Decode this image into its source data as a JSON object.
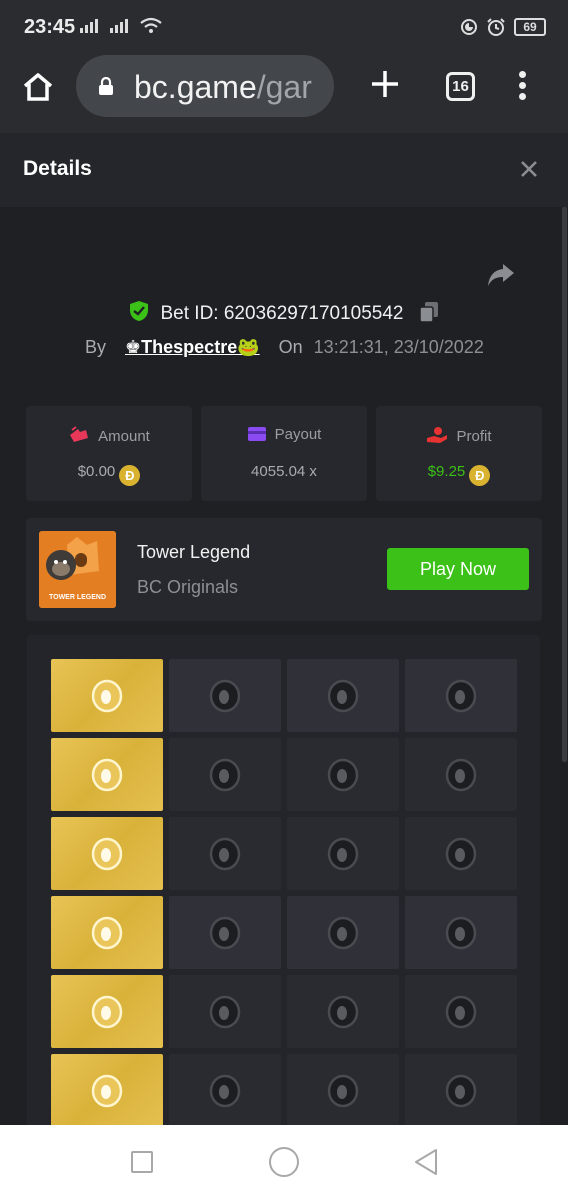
{
  "status_bar": {
    "time": "23:45",
    "battery": "69"
  },
  "browser": {
    "url_host": "bc.game",
    "url_path": "/gar",
    "tab_count": "16"
  },
  "details": {
    "title": "Details"
  },
  "bet": {
    "id_label": "Bet ID:",
    "id_value": "62036297170105542",
    "by_label": "By",
    "user": "♚Thespectre🐸",
    "on_label": "On",
    "timestamp": "13:21:31, 23/10/2022"
  },
  "stats": {
    "amount": {
      "label": "Amount",
      "value": "$0.00",
      "color": "#e8385a"
    },
    "payout": {
      "label": "Payout",
      "value": "4055.04 x",
      "color": "#8a4bf2"
    },
    "profit": {
      "label": "Profit",
      "value": "$9.25",
      "color": "#e83333",
      "value_color": "#3bc117"
    },
    "currency_icon": "doge-coin-icon",
    "currency_glyph": "Ð"
  },
  "game": {
    "name": "Tower Legend",
    "provider": "BC Originals",
    "thumb_text": "TOWER LEGEND",
    "play_label": "Play Now"
  },
  "board": {
    "columns": 4,
    "rows": [
      [
        "gold",
        "dark1",
        "dark1",
        "dark1"
      ],
      [
        "gold",
        "dark2",
        "dark2",
        "dark2"
      ],
      [
        "gold",
        "dark2",
        "dark2",
        "dark2"
      ],
      [
        "gold",
        "dark1",
        "dark1",
        "dark1"
      ],
      [
        "gold",
        "dark2",
        "dark2",
        "dark2"
      ],
      [
        "gold",
        "dark2",
        "dark2",
        "dark2"
      ]
    ]
  },
  "colors": {
    "accent_green": "#3bc117",
    "gold": "#e0bb48",
    "bg": "#1e2024"
  }
}
